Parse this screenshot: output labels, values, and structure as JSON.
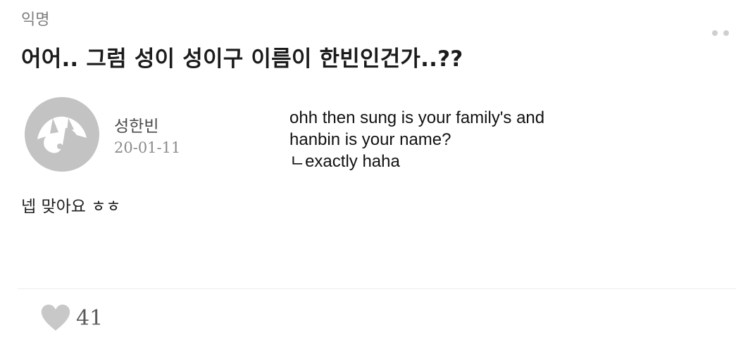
{
  "post": {
    "board_label": "익명",
    "title": "어어.. 그럼 성이 성이구 이름이 한빈인건가..??",
    "author": "성한빈",
    "date": "20-01-11",
    "body": "넵 맞아요 ㅎㅎ",
    "likes": "41"
  },
  "caption": {
    "line1": "ohh then sung is your family's and",
    "line2": "hanbin is your name?",
    "line3": "ㄴexactly haha"
  },
  "icons": {
    "more": "more-dots-icon",
    "avatar": "default-avatar-icon",
    "like": "heart-icon"
  },
  "colors": {
    "avatar_bg": "#c3c3c3",
    "heart": "#c8c8c8",
    "muted_text": "#8b8b8b"
  }
}
